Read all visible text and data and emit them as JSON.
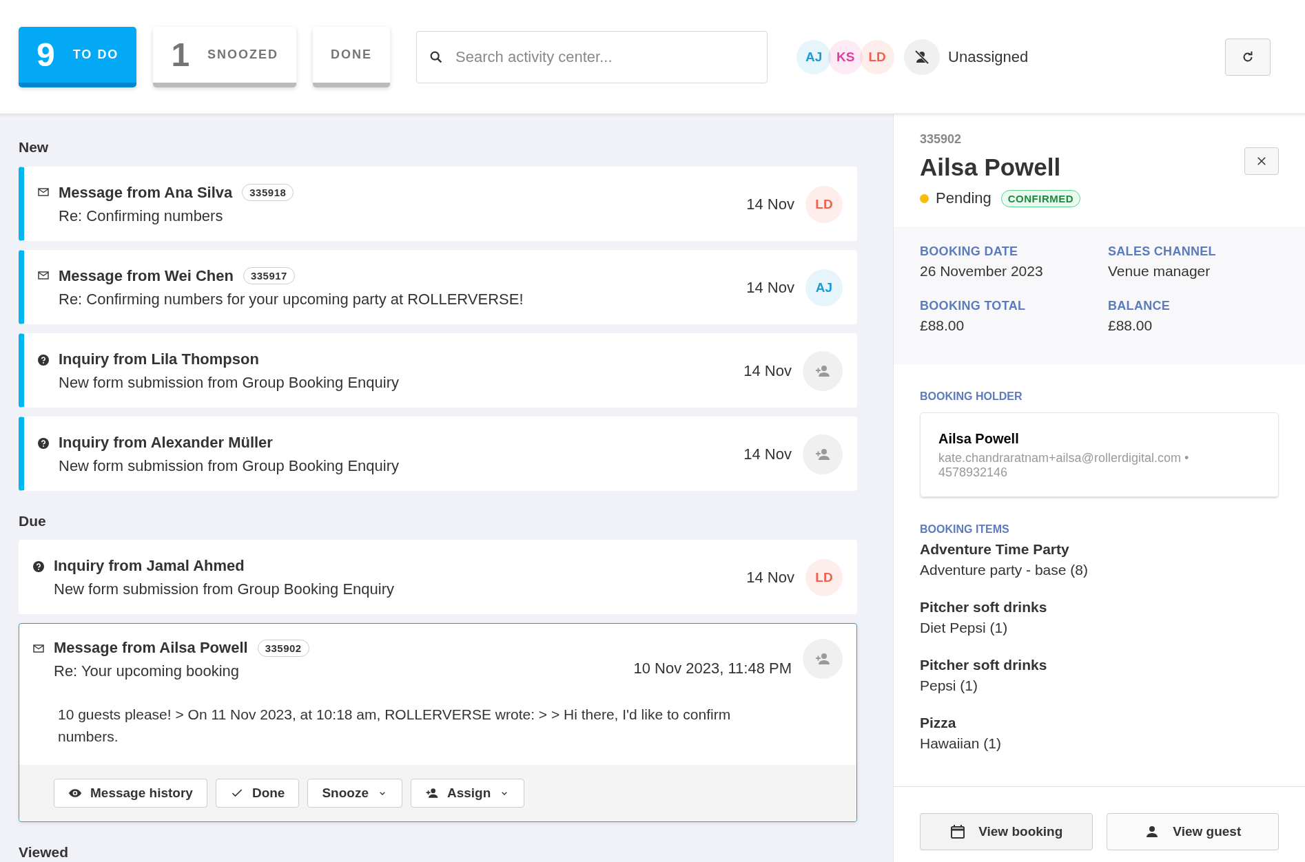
{
  "tabs": [
    {
      "count": "9",
      "label": "TO DO",
      "selected": true
    },
    {
      "count": "1",
      "label": "SNOOZED",
      "selected": false
    },
    {
      "label": "DONE",
      "selected": false
    }
  ],
  "search": {
    "placeholder": "Search activity center..."
  },
  "assignee_filter": {
    "avatars": [
      {
        "initials": "AJ",
        "color": "#1e9bd7"
      },
      {
        "initials": "KS",
        "color": "#e040a0"
      },
      {
        "initials": "LD",
        "color": "#f0604d"
      }
    ],
    "unassigned_label": "Unassigned"
  },
  "sections": [
    {
      "title": "New",
      "items": [
        {
          "kind": "message",
          "title": "Message from Ana Silva",
          "badge": "335918",
          "subtitle": "Re: Confirming numbers",
          "date": "14 Nov",
          "assignee": {
            "initials": "LD",
            "color": "#f0604d"
          },
          "unread": true,
          "selected": false
        },
        {
          "kind": "message",
          "title": "Message from Wei Chen",
          "badge": "335917",
          "subtitle": "Re: Confirming numbers for your upcoming party at ROLLERVERSE!",
          "date": "14 Nov",
          "assignee": {
            "initials": "AJ",
            "color": "#1e9bd7"
          },
          "unread": true,
          "selected": false
        },
        {
          "kind": "inquiry",
          "title": "Inquiry from Lila Thompson",
          "subtitle": "New form submission from Group Booking Enquiry",
          "date": "14 Nov",
          "unread": true,
          "selected": false
        },
        {
          "kind": "inquiry",
          "title": "Inquiry from Alexander Müller",
          "subtitle": "New form submission from Group Booking Enquiry",
          "date": "14 Nov",
          "unread": true,
          "selected": false
        }
      ]
    },
    {
      "title": "Due",
      "items": [
        {
          "kind": "inquiry",
          "title": "Inquiry from Jamal Ahmed",
          "subtitle": "New form submission from Group Booking Enquiry",
          "date": "14 Nov",
          "assignee": {
            "initials": "LD",
            "color": "#f0604d"
          },
          "unread": false,
          "selected": false
        },
        {
          "kind": "message",
          "title": "Message from Ailsa Powell",
          "badge": "335902",
          "subtitle": "Re: Your upcoming booking",
          "date": "10 Nov 2023, 11:48 PM",
          "unread": false,
          "selected": true,
          "body": "10 guests please! > On 11 Nov 2023, at 10:18 am, ROLLERVERSE wrote: > > Hi there, I'd like to confirm numbers.",
          "actions": [
            {
              "kind": "history",
              "label": "Message history"
            },
            {
              "kind": "done",
              "label": "Done"
            },
            {
              "kind": "snooze",
              "label": "Snooze"
            },
            {
              "kind": "assign",
              "label": "Assign"
            }
          ]
        }
      ]
    },
    {
      "title": "Viewed"
    }
  ],
  "detail": {
    "id": "335902",
    "name": "Ailsa Powell",
    "status": {
      "label": "Pending",
      "color": "#fbbc05"
    },
    "tag": "CONFIRMED",
    "fields": [
      {
        "label": "BOOKING DATE",
        "value": "26 November 2023"
      },
      {
        "label": "SALES CHANNEL",
        "value": "Venue manager"
      },
      {
        "label": "BOOKING TOTAL",
        "value": "£88.00"
      },
      {
        "label": "BALANCE",
        "value": "£88.00"
      }
    ],
    "holder_heading": "BOOKING HOLDER",
    "holder": {
      "name": "Ailsa Powell",
      "contact": "kate.chandraratnam+ailsa@rollerdigital.com • 4578932146"
    },
    "items_heading": "BOOKING ITEMS",
    "items": [
      {
        "name": "Adventure Time Party",
        "detail": "Adventure party - base (8)"
      },
      {
        "name": "Pitcher soft drinks",
        "detail": "Diet Pepsi (1)"
      },
      {
        "name": "Pitcher soft drinks",
        "detail": "Pepsi (1)"
      },
      {
        "name": "Pizza",
        "detail": "Hawaiian (1)"
      }
    ],
    "buttons": [
      {
        "kind": "booking",
        "label": "View booking"
      },
      {
        "kind": "guest",
        "label": "View guest"
      }
    ]
  }
}
